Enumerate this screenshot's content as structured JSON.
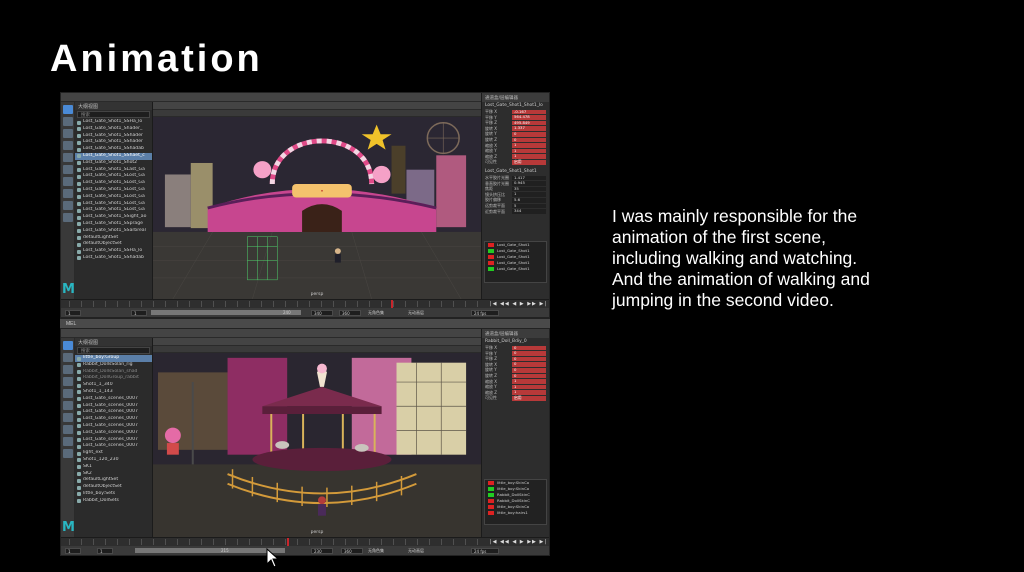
{
  "slide": {
    "title": "Animation",
    "description_lines": [
      "I was mainly responsible for the",
      "animation of the first scene,",
      "including walking and watching.",
      "And the animation of walking and",
      "jumping in the second video."
    ]
  },
  "top_window": {
    "outliner_header": "大纲视图",
    "outliner_search": "搜索",
    "outliner_items": [
      "Lost_Gate_Shot1_SSHa_lo",
      "Lost_Gate_Shot1_Shader_",
      "Lost_Gate_Shot1_SShader",
      "Lost_Gate_Shot1_SShader",
      "Lost_Gate_Shot1_SShadab",
      "Lost_Gate_Shot1_SShaet_c",
      "Lost_Gate_Shot1_Shot2",
      "Lost_Gate_Shot1_SLast_Ga",
      "Lost_Gate_Shot1_SLost_Ga",
      "Lost_Gate_Shot1_SLost_Ga",
      "Lost_Gate_Shot1_SLost_Ga",
      "Lost_Gate_Shot1_SLost_Ga",
      "Lost_Gate_Shot1_SLost_Ga",
      "Lost_Gate_Shot1_SLost_Ga",
      "Lost_Gate_Shot1_SSight_ao",
      "Lost_Gate_Shot1_SSprage",
      "Lost_Gate_Shot1_SSarbreal",
      "defaultLightSet",
      "defaultObjectSet",
      "Lost_Gate_Shot1_SSHa_lo",
      "Lost_Gate_Shot1_SShadab"
    ],
    "camera_label": "persp",
    "right_tabs": "通道盒/层编辑器",
    "attr_title": "Lost_Gate_Shot1_Shot1_lo",
    "attrs": [
      {
        "label": "平移 X",
        "value": "-0.167"
      },
      {
        "label": "平移 Y",
        "value": "564.478"
      },
      {
        "label": "平移 Z",
        "value": "495.849"
      },
      {
        "label": "旋转 X",
        "value": "1.337"
      },
      {
        "label": "旋转 Y",
        "value": "0"
      },
      {
        "label": "旋转 Z",
        "value": "0"
      },
      {
        "label": "缩放 X",
        "value": "1"
      },
      {
        "label": "缩放 Y",
        "value": "1"
      },
      {
        "label": "缩放 Z",
        "value": "1"
      },
      {
        "label": "可见性",
        "value": "启用"
      }
    ],
    "shape_title": "Lost_Gate_Shot1_Shot1",
    "shape_attrs": [
      {
        "label": "水平胶片光圈",
        "value": "1.417"
      },
      {
        "label": "垂直胶片光圈",
        "value": "0.945"
      },
      {
        "label": "焦距",
        "value": "35"
      },
      {
        "label": "镜头挤压比",
        "value": "1"
      },
      {
        "label": "胶片偏移",
        "value": "5.6"
      },
      {
        "label": "远剪裁平面",
        "value": "5"
      },
      {
        "label": "近剪裁平面",
        "value": "344"
      }
    ],
    "layers": [
      "Lost_Gate_Shot1",
      "Lost_Gate_Shot1",
      "Lost_Gate_Shot1",
      "Lost_Gate_Shot1",
      "Lost_Gate_Shot1"
    ],
    "range_start": "1",
    "range_current": "240",
    "range_end": "340",
    "range_max": "360",
    "playback_label": "无角色集",
    "anim_layer": "无动画层",
    "fps": "24 fps"
  },
  "between_bar": {
    "label": "MEL"
  },
  "bottom_window": {
    "outliner_header": "大纲视图",
    "outliner_search": "搜索",
    "outliner_items": [
      "little_boy:Group",
      "Rabbit_DollsSolan_rig",
      "Rabbit_DollsSolan_shad",
      "Rabbit_DollGroup_rabbit",
      "Shot1_1_340",
      "Shot1_1_143",
      "Lost_Gate_scenes_0007",
      "Lost_Gate_scenes_0007",
      "Lost_Gate_scenes_0007",
      "Lost_Gate_scenes_0007",
      "Lost_Gate_scenes_0007",
      "Lost_Gate_scenes_0007",
      "Lost_Gate_scenes_0007",
      "Lost_Gate_scenes_0007",
      "light_ext",
      "Shot1_120_230",
      "SK1",
      "SK2",
      "defaultLightSet",
      "defaultObjectSet",
      "little_boy:Sets",
      "Rabbit_DollSets"
    ],
    "camera_label": "persp",
    "right_tabs": "通道盒/层编辑器",
    "attr_title": "Rabbit_Doll_Bdiy_0",
    "attrs": [
      {
        "label": "平移 X",
        "value": "0"
      },
      {
        "label": "平移 Y",
        "value": "0"
      },
      {
        "label": "平移 Z",
        "value": "0"
      },
      {
        "label": "旋转 X",
        "value": "0"
      },
      {
        "label": "旋转 Y",
        "value": "0"
      },
      {
        "label": "旋转 Z",
        "value": "0"
      },
      {
        "label": "缩放 X",
        "value": "1"
      },
      {
        "label": "缩放 Y",
        "value": "1"
      },
      {
        "label": "缩放 Z",
        "value": "1"
      },
      {
        "label": "可见性",
        "value": "启用"
      }
    ],
    "layers": [
      "little_boy:SkinCo",
      "little_boy:SkinCo",
      "Rabbit_DollSkinC",
      "Rabbit_DollSkinC",
      "little_boy:SkinCo",
      "little_boy:hairs1"
    ],
    "range_start": "1",
    "range_current": "215",
    "range_end": "230",
    "range_max": "360",
    "playback_label": "无角色集",
    "anim_layer": "无动画层",
    "fps": "24 fps"
  },
  "colors": {
    "background": "#000000",
    "maya_accent": "#29b6c2",
    "selection": "#5b7fa8",
    "keyed_attr": "#b73939",
    "playhead": "#c8262c"
  },
  "icons": [
    "maya-logo-icon",
    "mouse-cursor-icon",
    "play-icon",
    "step-forward-icon",
    "step-back-icon"
  ]
}
